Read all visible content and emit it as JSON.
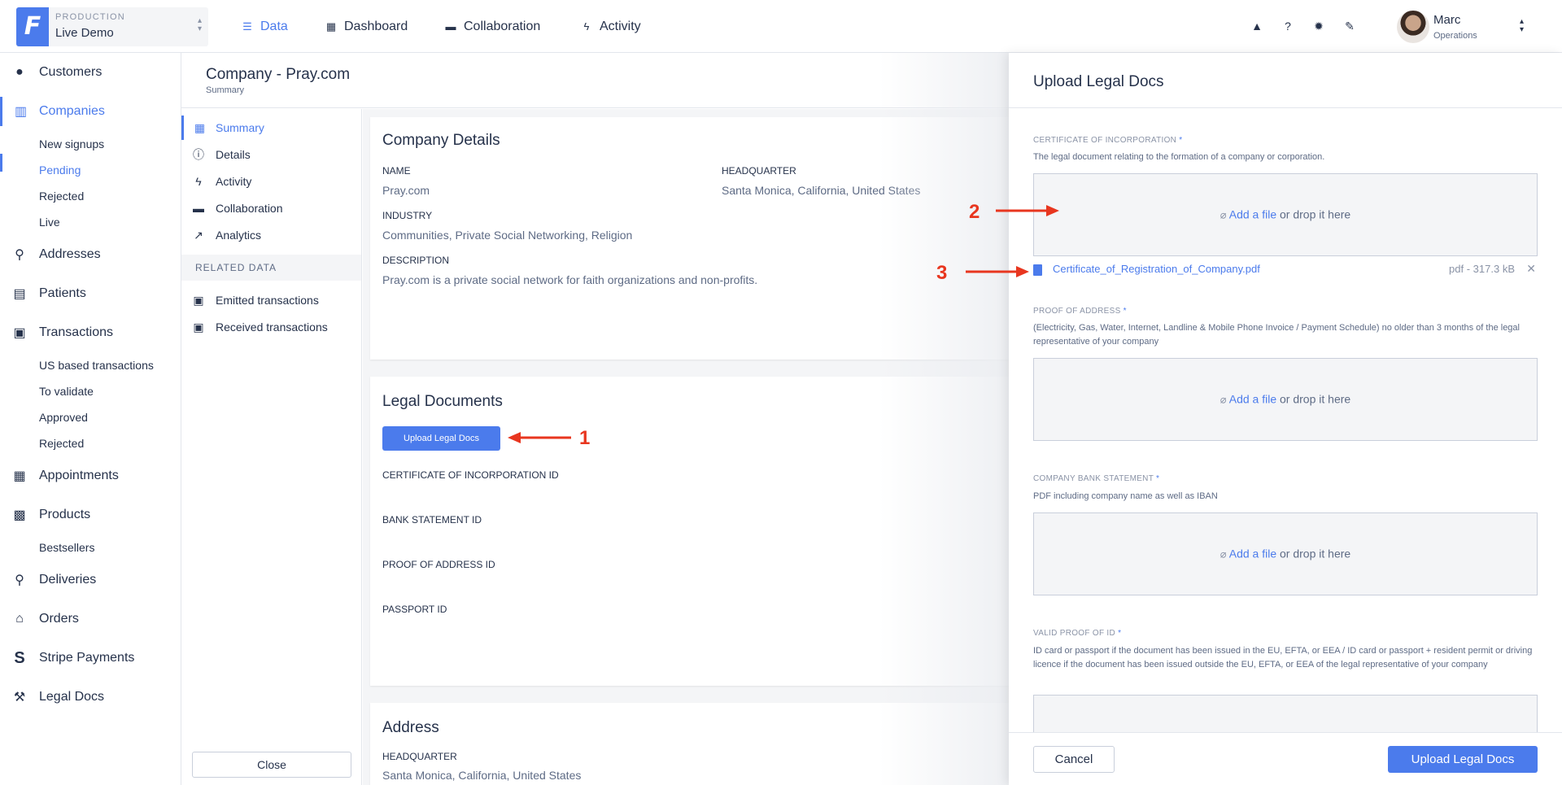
{
  "project": {
    "env": "PRODUCTION",
    "name": "Live Demo",
    "logo": "F"
  },
  "topnav": [
    {
      "label": "Data",
      "icon": "list-icon"
    },
    {
      "label": "Dashboard",
      "icon": "dashboard-icon"
    },
    {
      "label": "Collaboration",
      "icon": "chat-icon"
    },
    {
      "label": "Activity",
      "icon": "bolt-icon"
    }
  ],
  "user": {
    "name": "Marc",
    "role": "Operations"
  },
  "sidebar": {
    "customers": "Customers",
    "companies": "Companies",
    "companies_sub": [
      "New signups",
      "Pending",
      "Rejected",
      "Live"
    ],
    "addresses": "Addresses",
    "patients": "Patients",
    "transactions": "Transactions",
    "transactions_sub": [
      "US based transactions",
      "To validate",
      "Approved",
      "Rejected"
    ],
    "appointments": "Appointments",
    "products": "Products",
    "products_sub": [
      "Bestsellers"
    ],
    "deliveries": "Deliveries",
    "orders": "Orders",
    "stripe": "Stripe Payments",
    "legal": "Legal Docs"
  },
  "page": {
    "title": "Company - Pray.com",
    "subtitle": "Summary"
  },
  "subnav": {
    "items": [
      "Summary",
      "Details",
      "Activity",
      "Collaboration",
      "Analytics"
    ],
    "section": "RELATED DATA",
    "related": [
      "Emitted transactions",
      "Received transactions"
    ],
    "close": "Close"
  },
  "company_details": {
    "title": "Company Details",
    "name_label": "Name",
    "name": "Pray.com",
    "hq_label": "Headquarter",
    "hq": "Santa Monica, California, United States",
    "industry_label": "Industry",
    "industry": "Communities, Private Social Networking, Religion",
    "description_label": "Description",
    "description": "Pray.com is a private social network for faith organizations and non-profits."
  },
  "legal_documents": {
    "title": "Legal Documents",
    "button": "Upload Legal Docs",
    "fields": [
      "Certificate of Incorporation ID",
      "Bank Statement ID",
      "Proof of Address ID",
      "Passport ID"
    ]
  },
  "address": {
    "title": "Address",
    "hq_label": "Headquarter",
    "hq": "Santa Monica, California, United States"
  },
  "annotations": [
    "1",
    "2",
    "3"
  ],
  "annotation_color": "#e8361f",
  "drawer": {
    "title": "Upload Legal Docs",
    "add_file": "Add a file",
    "drop_text": " or drop it here",
    "sections": [
      {
        "label": "Certificate of Incorporation",
        "desc": "The legal document relating to the formation of a company or corporation."
      },
      {
        "label": "Proof of Address",
        "desc": "(Electricity, Gas, Water, Internet, Landline & Mobile Phone Invoice / Payment Schedule) no older than 3 months of the legal representative of your company"
      },
      {
        "label": "Company Bank Statement",
        "desc": "PDF including company name as well as IBAN"
      },
      {
        "label": "Valid Proof of ID",
        "desc": "ID card or passport if the document has been issued in the EU, EFTA, or EEA / ID card or passport + resident permit or driving licence if the document has been issued outside the EU, EFTA, or EEA of the legal representative of your company"
      }
    ],
    "file": {
      "name": "Certificate_of_Registration_of_Company.pdf",
      "size": "pdf - 317.3 kB"
    },
    "cancel": "Cancel",
    "submit": "Upload Legal Docs"
  },
  "accent_color": "#4b7bec"
}
